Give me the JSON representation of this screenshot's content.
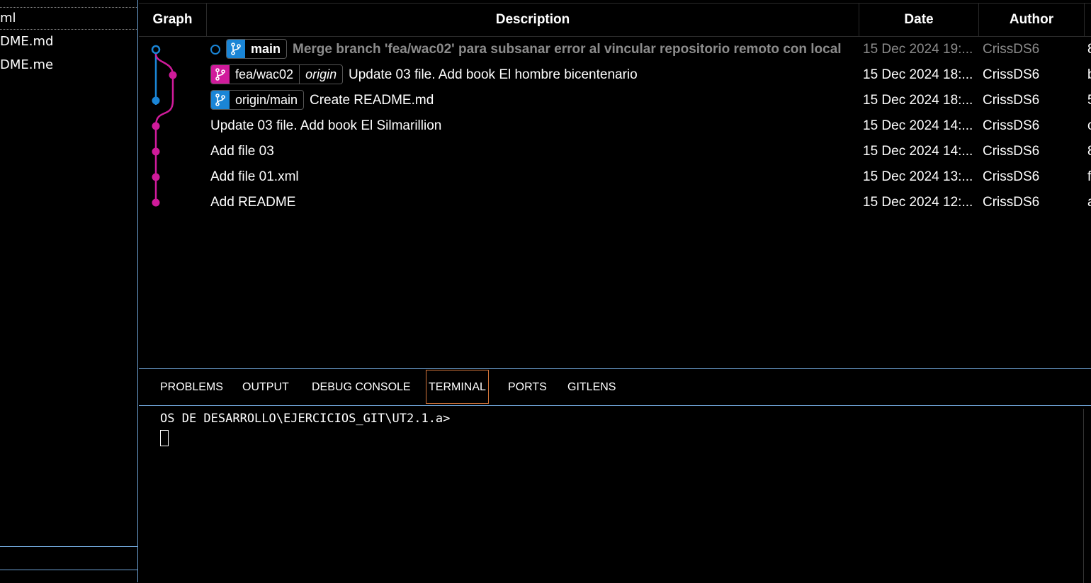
{
  "sidebar": {
    "files": [
      "ml",
      "DME.md",
      "DME.me"
    ]
  },
  "graph": {
    "columns": {
      "graph": "Graph",
      "description": "Description",
      "date": "Date",
      "author": "Author"
    },
    "commits": [
      {
        "message": "Merge branch 'fea/wac02' para subsanar error al vincular repositorio remoto con local",
        "date": "15 Dec 2024 19:...",
        "author": "CrissDS6",
        "sha": "8",
        "dimmed": true,
        "refs": [
          {
            "label": "main",
            "remote": "",
            "color": "#1a85d6"
          }
        ]
      },
      {
        "message": "Update 03 file. Add book El hombre bicentenario",
        "date": "15 Dec 2024 18:...",
        "author": "CrissDS6",
        "sha": "b",
        "refs": [
          {
            "label": "fea/wac02",
            "remote": "origin",
            "color": "#d01b9b"
          }
        ]
      },
      {
        "message": "Create README.md",
        "date": "15 Dec 2024 18:...",
        "author": "CrissDS6",
        "sha": "5",
        "refs": [
          {
            "label": "origin/main",
            "remote": "",
            "color": "#1a85d6"
          }
        ]
      },
      {
        "message": "Update 03 file. Add book El Silmarillion",
        "date": "15 Dec 2024 14:...",
        "author": "CrissDS6",
        "sha": "c",
        "refs": []
      },
      {
        "message": "Add file 03",
        "date": "15 Dec 2024 14:...",
        "author": "CrissDS6",
        "sha": "8",
        "refs": []
      },
      {
        "message": "Add file 01.xml",
        "date": "15 Dec 2024 13:...",
        "author": "CrissDS6",
        "sha": "f",
        "refs": []
      },
      {
        "message": "Add README",
        "date": "15 Dec 2024 12:...",
        "author": "CrissDS6",
        "sha": "a",
        "refs": []
      }
    ],
    "lane_colors": {
      "main": "#1a85d6",
      "feature": "#d01b9b"
    }
  },
  "panel": {
    "tabs": [
      "PROBLEMS",
      "OUTPUT",
      "DEBUG CONSOLE",
      "TERMINAL",
      "PORTS",
      "GITLENS"
    ],
    "active_tab": "TERMINAL",
    "terminal_prompt": "OS DE DESARROLLO\\EJERCICIOS_GIT\\UT2.1.a>"
  }
}
